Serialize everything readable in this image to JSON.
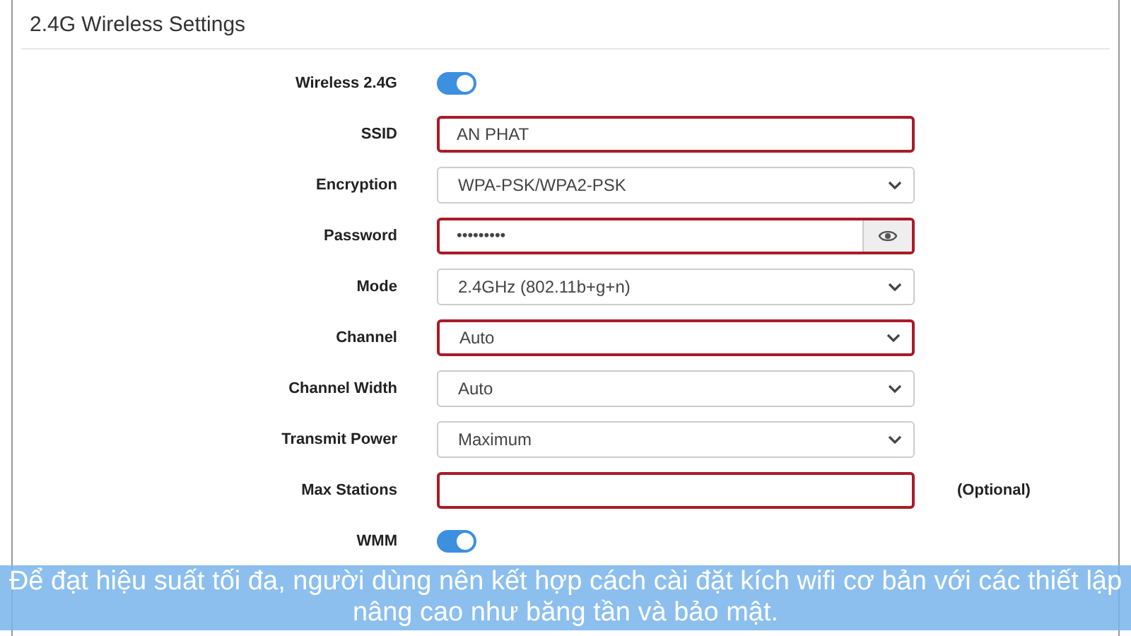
{
  "panel": {
    "title": "2.4G Wireless Settings"
  },
  "fields": [
    {
      "label": "Wireless 2.4G",
      "kind": "toggle",
      "on": true
    },
    {
      "label": "SSID",
      "kind": "text",
      "value": "AN PHAT",
      "highlighted": true
    },
    {
      "label": "Encryption",
      "kind": "select",
      "value": "WPA-PSK/WPA2-PSK",
      "highlighted": false
    },
    {
      "label": "Password",
      "kind": "password",
      "value": "•••••••••",
      "highlighted": true
    },
    {
      "label": "Mode",
      "kind": "select",
      "value": "2.4GHz (802.11b+g+n)",
      "highlighted": false
    },
    {
      "label": "Channel",
      "kind": "select",
      "value": "Auto",
      "highlighted": true
    },
    {
      "label": "Channel Width",
      "kind": "select",
      "value": "Auto",
      "highlighted": false
    },
    {
      "label": "Transmit Power",
      "kind": "select",
      "value": "Maximum",
      "highlighted": false
    },
    {
      "label": "Max Stations",
      "kind": "text",
      "highlighted": true,
      "note": "(Optional)"
    },
    {
      "label": "WMM",
      "kind": "toggle",
      "on": true
    }
  ],
  "caption": "Để đạt hiệu suất tối đa, người dùng nên kết hợp cách cài đặt kích wifi cơ bản với các thiết lập nâng cao như băng tần và bảo mật."
}
